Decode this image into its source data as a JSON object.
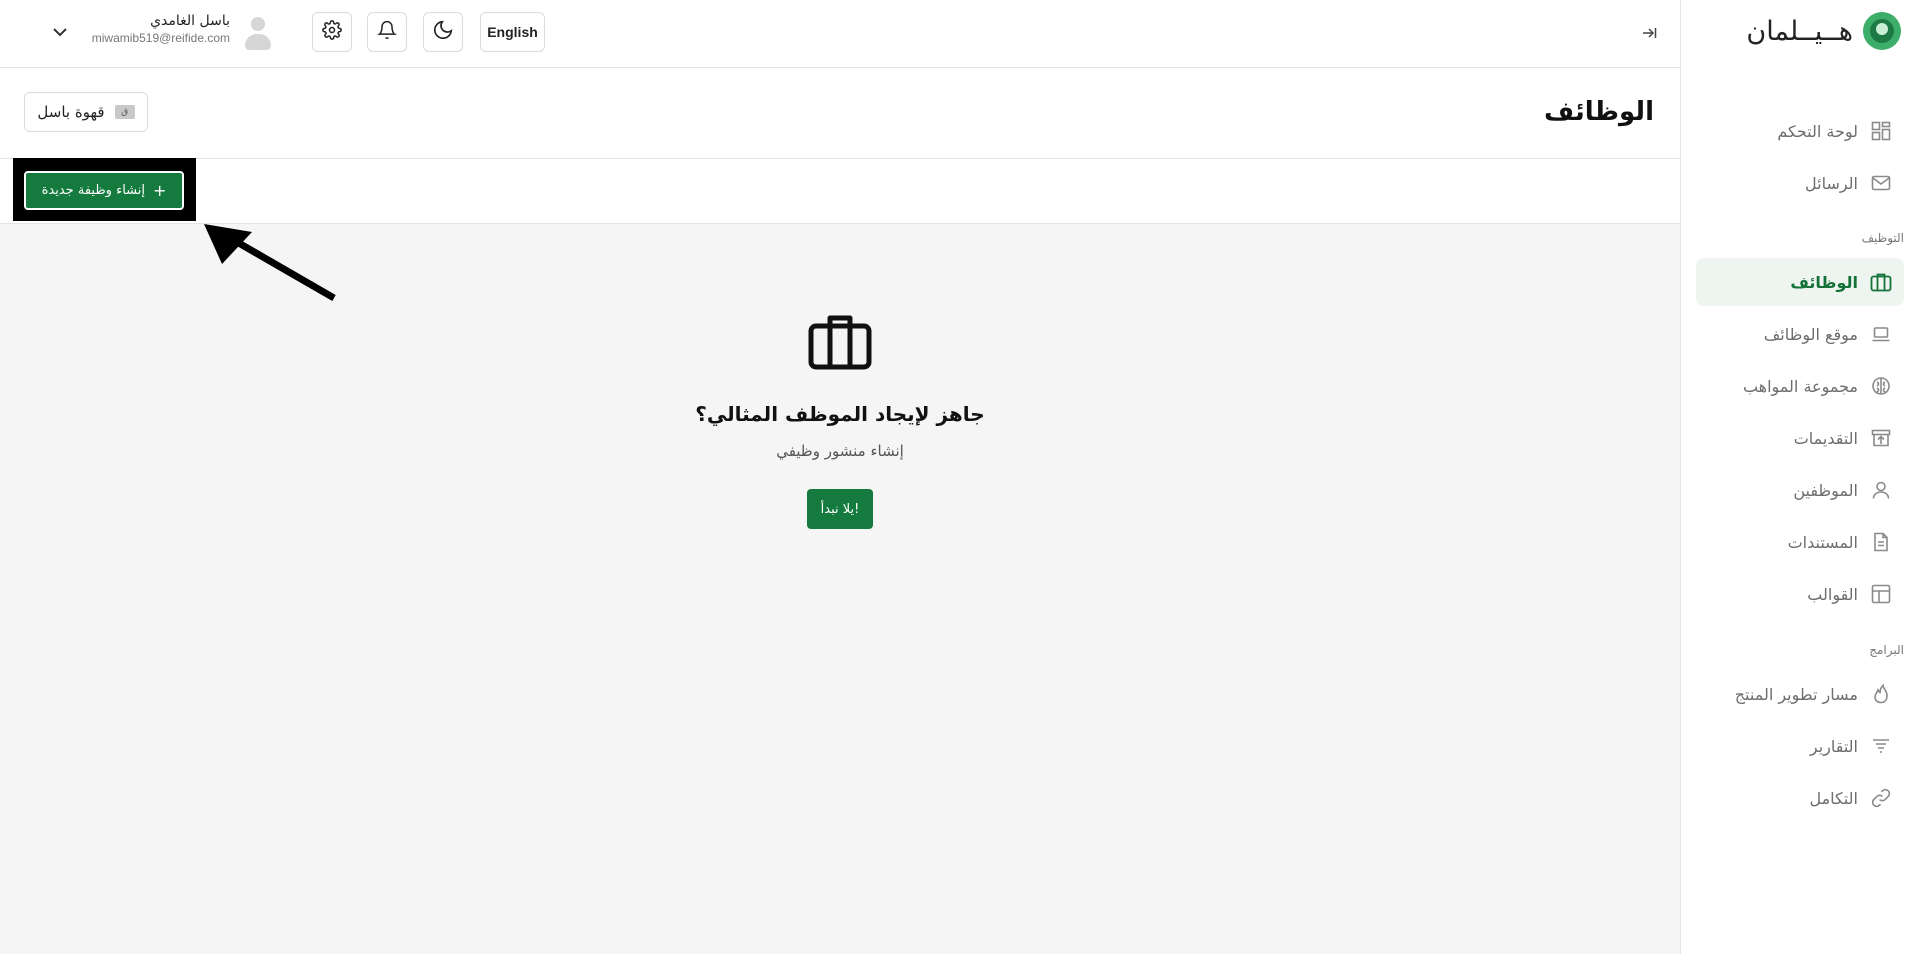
{
  "brand": {
    "name": "هــيــلمان",
    "accent_color": "#157a3e"
  },
  "topbar": {
    "language_button": "English",
    "theme_icon": "moon-icon",
    "notifications_icon": "bell-icon",
    "settings_icon": "gear-icon",
    "user": {
      "name": "باسل الغامدي",
      "email": "miwamib519@reifide.com"
    }
  },
  "sidebar": {
    "items_top": [
      {
        "label": "لوحة التحكم",
        "icon": "dashboard-grid-icon"
      },
      {
        "label": "الرسائل",
        "icon": "mail-icon"
      }
    ],
    "section_hiring": "التوظيف",
    "items_hiring": [
      {
        "label": "الوظائف",
        "icon": "briefcase-icon",
        "active": true
      },
      {
        "label": "موقع الوظائف",
        "icon": "laptop-icon"
      },
      {
        "label": "مجموعة المواهب",
        "icon": "brain-icon"
      },
      {
        "label": "التقديمات",
        "icon": "inbox-upload-icon"
      },
      {
        "label": "الموظفين",
        "icon": "person-icon"
      },
      {
        "label": "المستندات",
        "icon": "document-icon"
      },
      {
        "label": "القوالب",
        "icon": "layout-template-icon"
      }
    ],
    "section_programs": "البرامج",
    "items_programs": [
      {
        "label": "مسار تطوير المنتج",
        "icon": "flame-icon"
      },
      {
        "label": "التقارير",
        "icon": "filter-lines-icon"
      },
      {
        "label": "التكامل",
        "icon": "link-icon"
      }
    ]
  },
  "page": {
    "title": "الوظائف",
    "company_button": "قهوة باسل",
    "company_logo_text": "ق",
    "create_job_button": "إنشاء وظيفة جديدة"
  },
  "empty_state": {
    "icon": "briefcase-icon",
    "title": "جاهز لإيجاد الموظف المثالي؟",
    "subtitle": "إنشاء منشور وظيفي",
    "cta": "يلا نبدأ!"
  }
}
